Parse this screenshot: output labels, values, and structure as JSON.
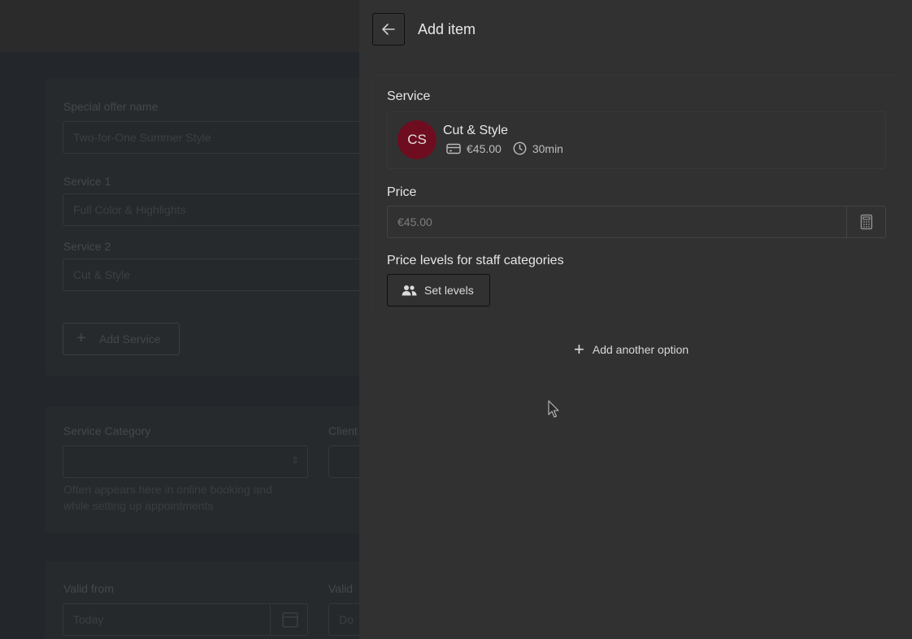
{
  "background_form": {
    "special_offer_label": "Special offer name",
    "special_offer_value": "Two-for-One Summer Style",
    "service1_label": "Service 1",
    "service1_value": "Full Color & Highlights",
    "service2_label": "Service 2",
    "service2_value": "Cut & Style",
    "add_service_label": "Add Service",
    "service_category_label": "Service Category",
    "client_label": "Client",
    "category_hint_line1": "Often appears here in online booking and",
    "category_hint_line2": "while setting up appointments",
    "valid_from_label": "Valid from",
    "valid_from_value": "Today",
    "valid_to_label": "Valid",
    "valid_to_value": "Do"
  },
  "drawer": {
    "title": "Add item",
    "service_label": "Service",
    "service": {
      "initials": "CS",
      "name": "Cut & Style",
      "price": "€45.00",
      "duration": "30min",
      "avatar_color": "#6e0d1f"
    },
    "price_label": "Price",
    "price_value": "€45.00",
    "price_levels_label": "Price levels for staff categories",
    "set_levels_button": "Set levels",
    "add_option_button": "Add another option"
  },
  "icons": [
    "arrow-left-icon",
    "wallet-icon",
    "clock-icon",
    "calculator-icon",
    "users-icon",
    "plus-icon",
    "calendar-icon",
    "cursor-icon"
  ]
}
